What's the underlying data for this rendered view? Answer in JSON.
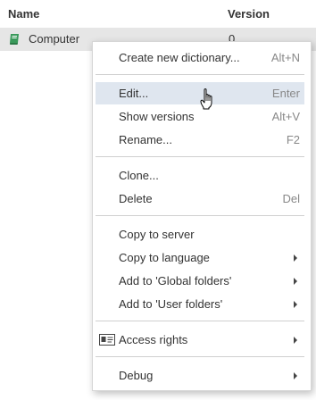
{
  "table": {
    "columns": {
      "name": "Name",
      "version": "Version"
    },
    "row": {
      "name": "Computer",
      "version": "0",
      "icon": "book-icon",
      "icon_color": "#3a9a5b"
    }
  },
  "menu": {
    "hover_color": "#dfe6ef",
    "items": {
      "create": {
        "label": "Create new dictionary...",
        "shortcut": "Alt+N"
      },
      "edit": {
        "label": "Edit...",
        "shortcut": "Enter"
      },
      "show_versions": {
        "label": "Show versions",
        "shortcut": "Alt+V"
      },
      "rename": {
        "label": "Rename...",
        "shortcut": "F2"
      },
      "clone": {
        "label": "Clone..."
      },
      "delete": {
        "label": "Delete",
        "shortcut": "Del"
      },
      "copy_server": {
        "label": "Copy to server"
      },
      "copy_language": {
        "label": "Copy to language"
      },
      "add_global": {
        "label": "Add to 'Global folders'"
      },
      "add_user": {
        "label": "Add to 'User folders'"
      },
      "access_rights": {
        "label": "Access rights",
        "icon": "id-card-icon"
      },
      "debug": {
        "label": "Debug"
      }
    }
  }
}
